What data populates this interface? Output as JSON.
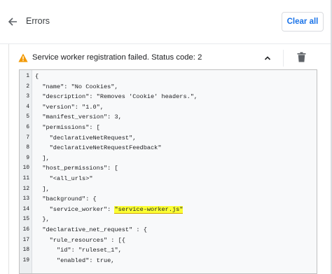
{
  "header": {
    "title": "Errors",
    "clear_all": "Clear all"
  },
  "error": {
    "message": "Service worker registration failed. Status code: 2",
    "warning_color": "#f29900",
    "highlight_color": "#fbff34"
  },
  "icons": {
    "back": "arrow-left-icon",
    "warning": "warning-triangle-icon",
    "collapse": "chevron-up-icon",
    "delete": "trash-icon"
  },
  "code": {
    "lines": [
      {
        "n": "1",
        "pre": "{",
        "hl": "",
        "post": ""
      },
      {
        "n": "2",
        "pre": "  \"name\": \"No Cookies\",",
        "hl": "",
        "post": ""
      },
      {
        "n": "3",
        "pre": "  \"description\": \"Removes 'Cookie' headers.\",",
        "hl": "",
        "post": ""
      },
      {
        "n": "4",
        "pre": "  \"version\": \"1.0\",",
        "hl": "",
        "post": ""
      },
      {
        "n": "5",
        "pre": "  \"manifest_version\": 3,",
        "hl": "",
        "post": ""
      },
      {
        "n": "6",
        "pre": "  \"permissions\": [",
        "hl": "",
        "post": ""
      },
      {
        "n": "7",
        "pre": "    \"declarativeNetRequest\",",
        "hl": "",
        "post": ""
      },
      {
        "n": "8",
        "pre": "    \"declarativeNetRequestFeedback\"",
        "hl": "",
        "post": ""
      },
      {
        "n": "9",
        "pre": "  ],",
        "hl": "",
        "post": ""
      },
      {
        "n": "10",
        "pre": "  \"host_permissions\": [",
        "hl": "",
        "post": ""
      },
      {
        "n": "11",
        "pre": "    \"<all_urls>\"",
        "hl": "",
        "post": ""
      },
      {
        "n": "12",
        "pre": "  ],",
        "hl": "",
        "post": ""
      },
      {
        "n": "13",
        "pre": "  \"background\": {",
        "hl": "",
        "post": ""
      },
      {
        "n": "14",
        "pre": "    \"service_worker\": ",
        "hl": "\"service-worker.js\"",
        "post": ""
      },
      {
        "n": "15",
        "pre": "  },",
        "hl": "",
        "post": ""
      },
      {
        "n": "16",
        "pre": "  \"declarative_net_request\" : {",
        "hl": "",
        "post": ""
      },
      {
        "n": "17",
        "pre": "    \"rule_resources\" : [{",
        "hl": "",
        "post": ""
      },
      {
        "n": "18",
        "pre": "      \"id\": \"ruleset_1\",",
        "hl": "",
        "post": ""
      },
      {
        "n": "19",
        "pre": "      \"enabled\": true,",
        "hl": "",
        "post": ""
      }
    ]
  }
}
